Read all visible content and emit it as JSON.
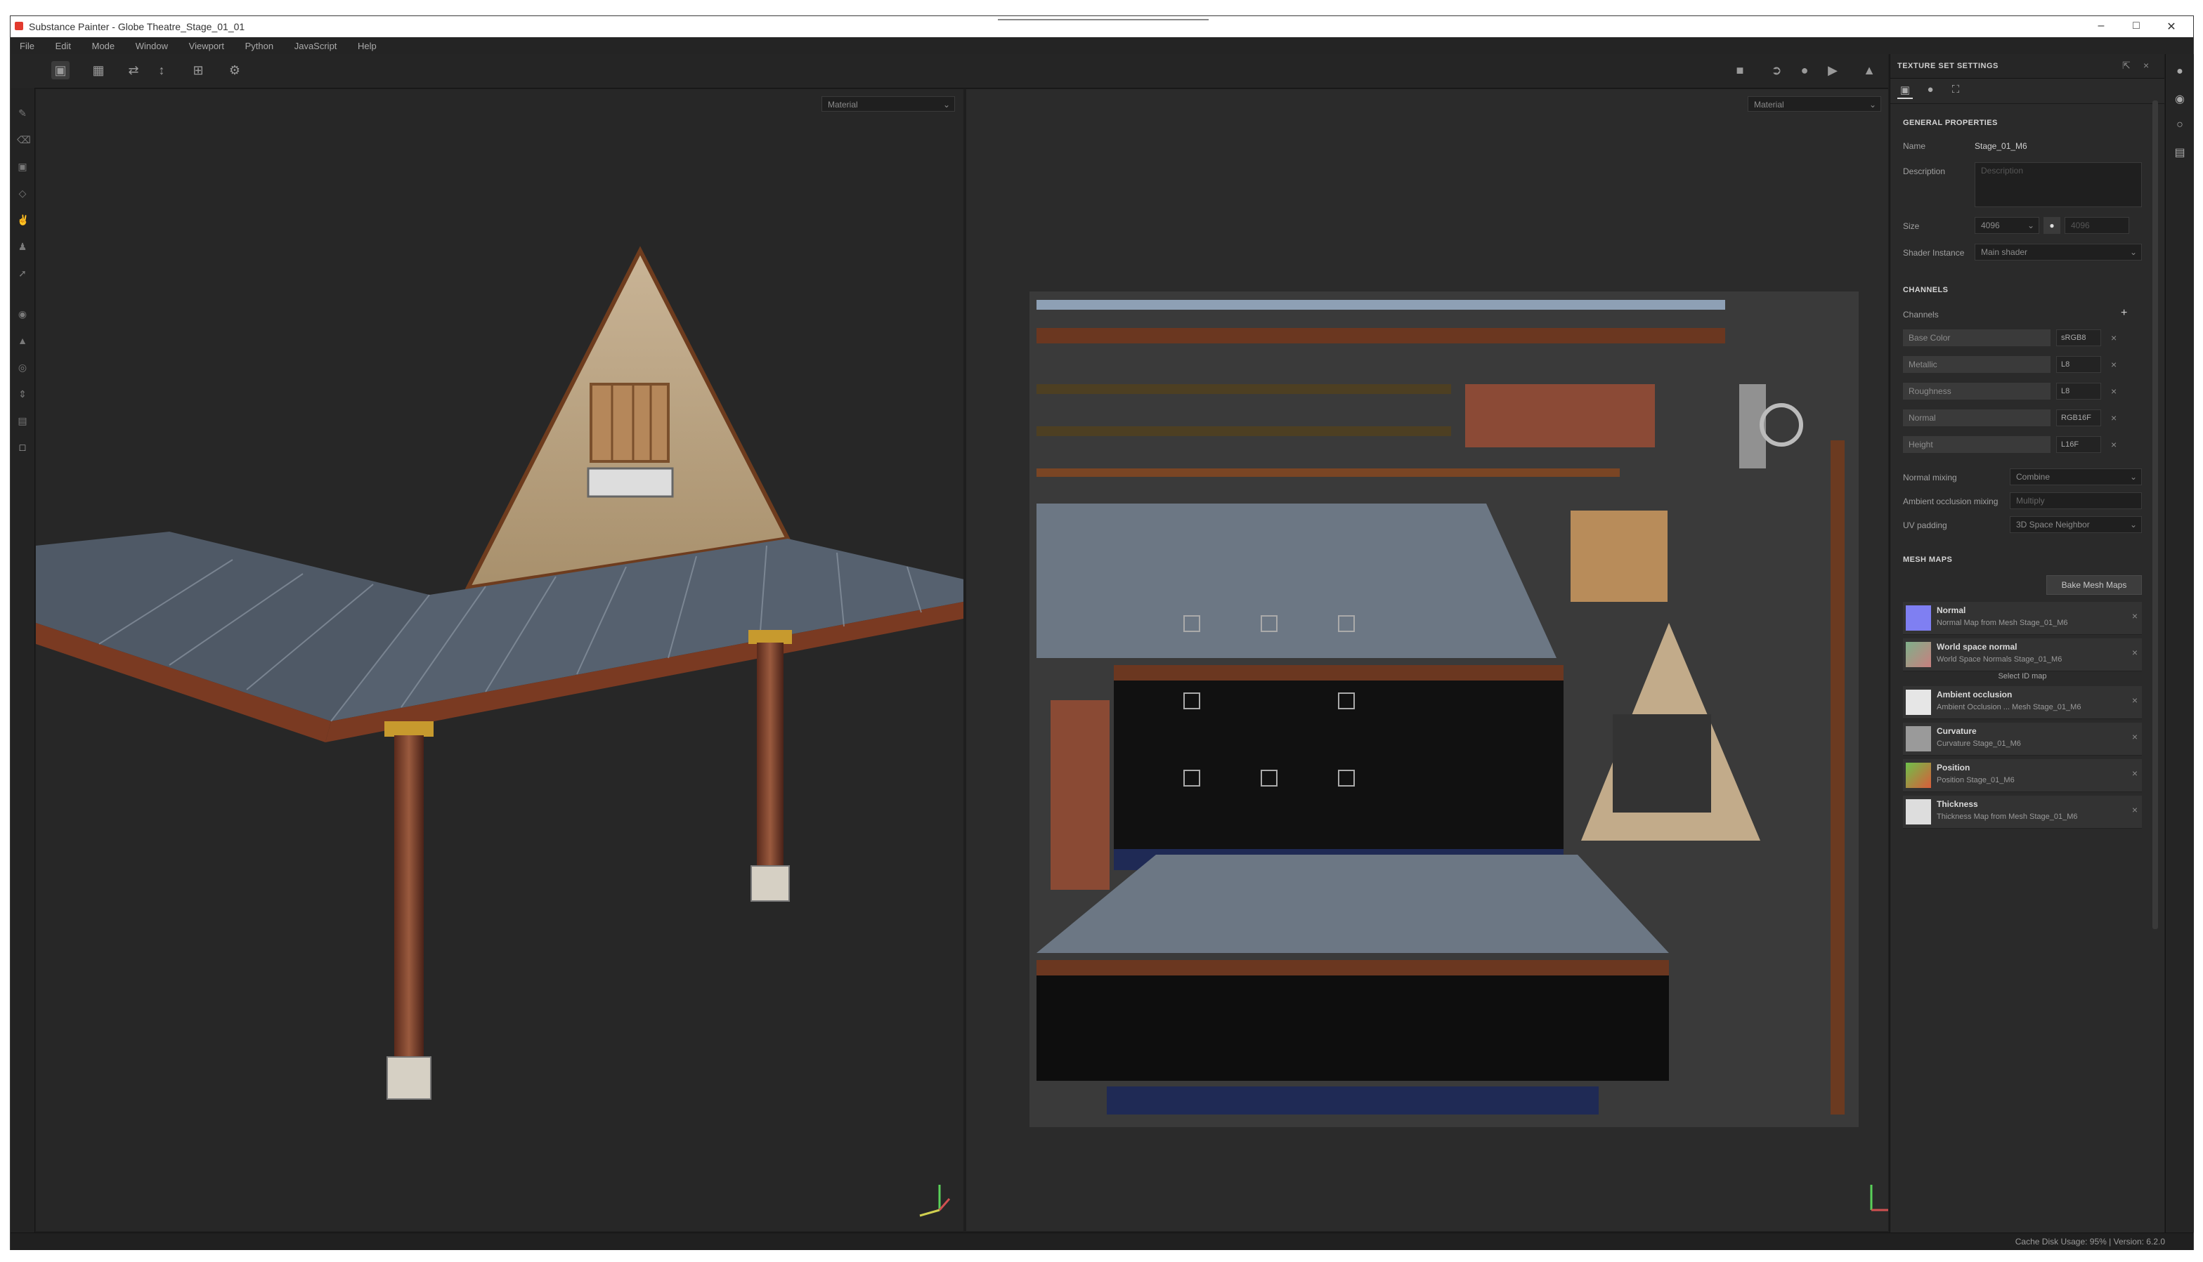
{
  "window": {
    "title": "Substance Painter - Globe Theatre_Stage_01_01",
    "controls": [
      "–",
      "□",
      "✕"
    ]
  },
  "menu": [
    "File",
    "Edit",
    "Mode",
    "Window",
    "Viewport",
    "Python",
    "JavaScript",
    "Help"
  ],
  "viewport3d": {
    "mode_dropdown": "Material"
  },
  "viewport2d": {
    "mode_dropdown": "Material"
  },
  "panel": {
    "title": "TEXTURE SET SETTINGS",
    "general": {
      "heading": "GENERAL PROPERTIES",
      "name_label": "Name",
      "name_value": "Stage_01_M6",
      "description_label": "Description",
      "description_placeholder": "Description",
      "size_label": "Size",
      "size_value": "4096",
      "size_value2": "4096",
      "shader_label": "Shader Instance",
      "shader_value": "Main shader"
    },
    "channels": {
      "heading": "CHANNELS",
      "label": "Channels",
      "items": [
        {
          "name": "Base Color",
          "format": "sRGB8"
        },
        {
          "name": "Metallic",
          "format": "L8"
        },
        {
          "name": "Roughness",
          "format": "L8"
        },
        {
          "name": "Normal",
          "format": "RGB16F"
        },
        {
          "name": "Height",
          "format": "L16F"
        }
      ],
      "normal_mixing_label": "Normal mixing",
      "normal_mixing_value": "Combine",
      "ao_mixing_label": "Ambient occlusion mixing",
      "ao_mixing_value": "Multiply",
      "uv_padding_label": "UV padding",
      "uv_padding_value": "3D Space Neighbor"
    },
    "mesh_maps": {
      "heading": "MESH MAPS",
      "bake_button": "Bake Mesh Maps",
      "select_label": "Select ID map",
      "items": [
        {
          "title": "Normal",
          "subtitle": "Normal Map from Mesh Stage_01_M6",
          "color": "#7f7ff2"
        },
        {
          "title": "World space normal",
          "subtitle": "World Space Normals Stage_01_M6",
          "color": "#7fb08a"
        },
        {
          "title": "Ambient occlusion",
          "subtitle": "Ambient Occlusion ... Mesh Stage_01_M6",
          "color": "#e6e6e6"
        },
        {
          "title": "Curvature",
          "subtitle": "Curvature Stage_01_M6",
          "color": "#9a9a9a"
        },
        {
          "title": "Position",
          "subtitle": "Position Stage_01_M6",
          "color": "#c8803c"
        },
        {
          "title": "Thickness",
          "subtitle": "Thickness Map from Mesh Stage_01_M6",
          "color": "#dddddd"
        }
      ]
    }
  },
  "status": {
    "right": "Cache Disk Usage:   95%  |  Version: 6.2.0"
  },
  "icons": {
    "toolbar": [
      "layout-1-icon",
      "layout-2-icon",
      "swap-icon",
      "uv-icon",
      "grid-icon",
      "settings-icon",
      "camera-icon",
      "render-icon",
      "sphere-icon",
      "video-icon",
      "share-icon"
    ],
    "left": [
      "brush-icon",
      "eraser-icon",
      "projection-icon",
      "geometry-icon",
      "smudge-icon",
      "clone-icon",
      "picker-icon",
      "bake-icon",
      "polygon-fill-icon",
      "color-picker-icon",
      "measure-icon",
      "stamp-icon",
      "document-icon"
    ]
  }
}
